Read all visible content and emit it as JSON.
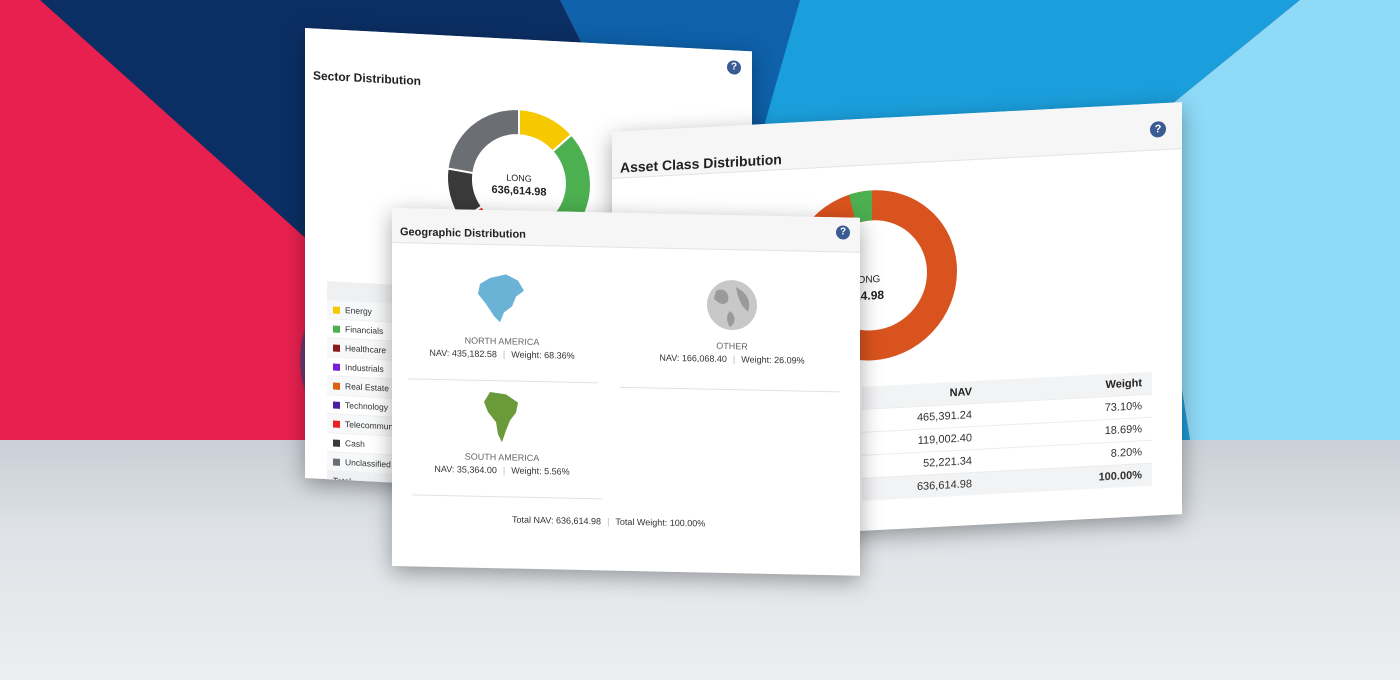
{
  "sector_panel": {
    "title": "Sector Distribution",
    "help_label": "?",
    "center_label": "LONG",
    "center_value": "636,614.98",
    "legend": [
      {
        "label": "Energy",
        "color": "#f5c800"
      },
      {
        "label": "Financials",
        "color": "#4caf50"
      },
      {
        "label": "Healthcare",
        "color": "#8b1a1a"
      },
      {
        "label": "Industrials",
        "color": "#7b1fd6"
      },
      {
        "label": "Real Estate",
        "color": "#e06010"
      },
      {
        "label": "Technology",
        "color": "#4b1f9e"
      },
      {
        "label": "Telecommunicat",
        "color": "#e8231f"
      },
      {
        "label": "Cash",
        "color": "#3a3a3a"
      },
      {
        "label": "Unclassified",
        "color": "#6b6e72"
      }
    ],
    "total_label": "Total"
  },
  "asset_panel": {
    "title": "Asset Class Distribution",
    "help_label": "?",
    "center_label": "LONG",
    "center_value": ",614.98",
    "columns": {
      "nav": "NAV",
      "weight": "Weight"
    },
    "rows": [
      {
        "nav": "465,391.24",
        "weight": "73.10%"
      },
      {
        "nav": "119,002.40",
        "weight": "18.69%"
      },
      {
        "nav": "52,221.34",
        "weight": "8.20%"
      }
    ],
    "total": {
      "nav": "636,614.98",
      "weight": "100.00%"
    }
  },
  "geo_panel": {
    "title": "Geographic Distribution",
    "help_label": "?",
    "regions": {
      "north_america": {
        "name": "NORTH AMERICA",
        "nav": "NAV: 435,182.58",
        "weight": "Weight: 68.36%"
      },
      "other": {
        "name": "OTHER",
        "nav": "NAV: 166,068.40",
        "weight": "Weight: 26.09%"
      },
      "south_america": {
        "name": "SOUTH AMERICA",
        "nav": "NAV: 35,364.00",
        "weight": "Weight: 5.56%"
      }
    },
    "total_nav": "Total NAV: 636,614.98",
    "total_weight": "Total Weight: 100.00%"
  },
  "colors": {
    "red_bg": "#e8204f",
    "navy_bg": "#0b3a73",
    "blue_bg": "#1ea2e0",
    "light_blue_bg": "#8fdaf7",
    "asset_orange": "#d9531e",
    "asset_green": "#4caf50",
    "na_blue": "#6bb3d6",
    "sa_green": "#6a9a3a"
  }
}
